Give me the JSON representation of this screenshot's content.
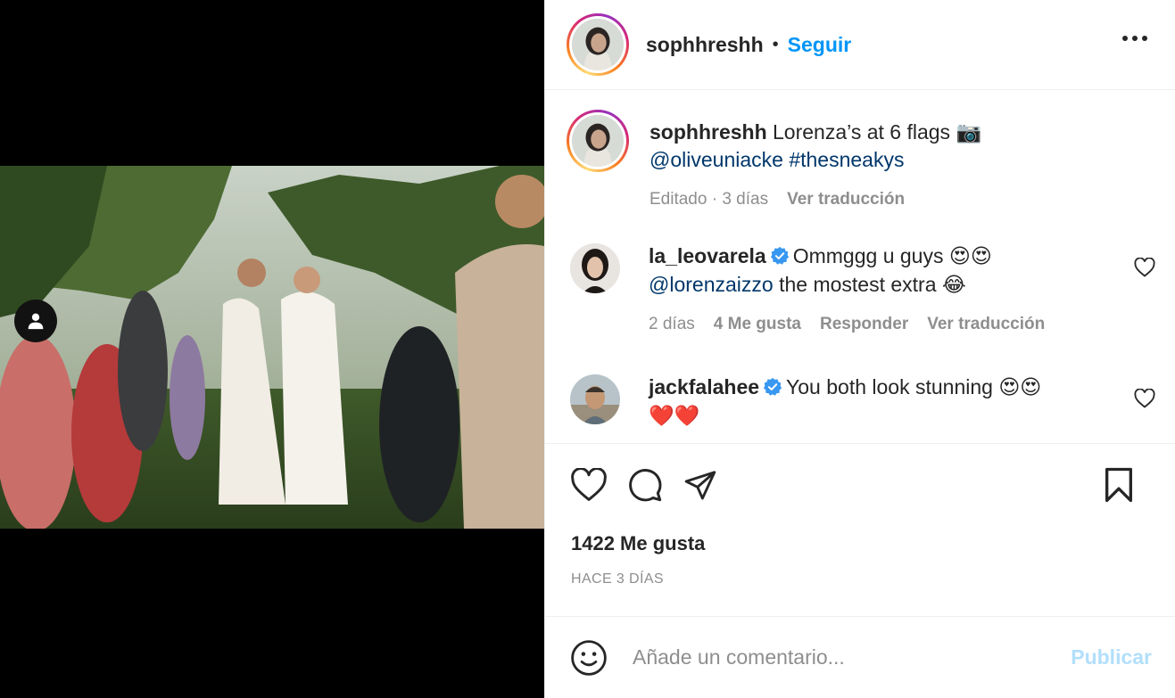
{
  "post": {
    "username": "sophhreshh",
    "follow_label": "Seguir",
    "dot": "•"
  },
  "caption": {
    "username": "sophhreshh",
    "text": "Lorenza’s at 6 flags 📷",
    "mention": "@oliveuniacke",
    "hashtag": "#thesneakys",
    "edited": "Editado · 3 días",
    "translate": "Ver traducción"
  },
  "comments": [
    {
      "username": "la_leovarela",
      "text": "Ommggg u guys 😍😍",
      "mention": "@lorenzaizzo",
      "text2": "the mostest extra 😂",
      "time": "2 días",
      "likes": "4 Me gusta",
      "reply": "Responder",
      "translate": "Ver traducción"
    },
    {
      "username": "jackfalahee",
      "text": "You both look stunning 😍😍",
      "text2": "❤️❤️"
    }
  ],
  "likes_count": "1422 Me gusta",
  "time_ago": "HACE 3 DÍAS",
  "add_comment": {
    "placeholder": "Añade un comentario...",
    "publish": "Publicar"
  },
  "colors": {
    "accent": "#0095f6",
    "link": "#00376b",
    "muted": "#8e8e8e",
    "publish_disabled": "#b2dffc"
  }
}
